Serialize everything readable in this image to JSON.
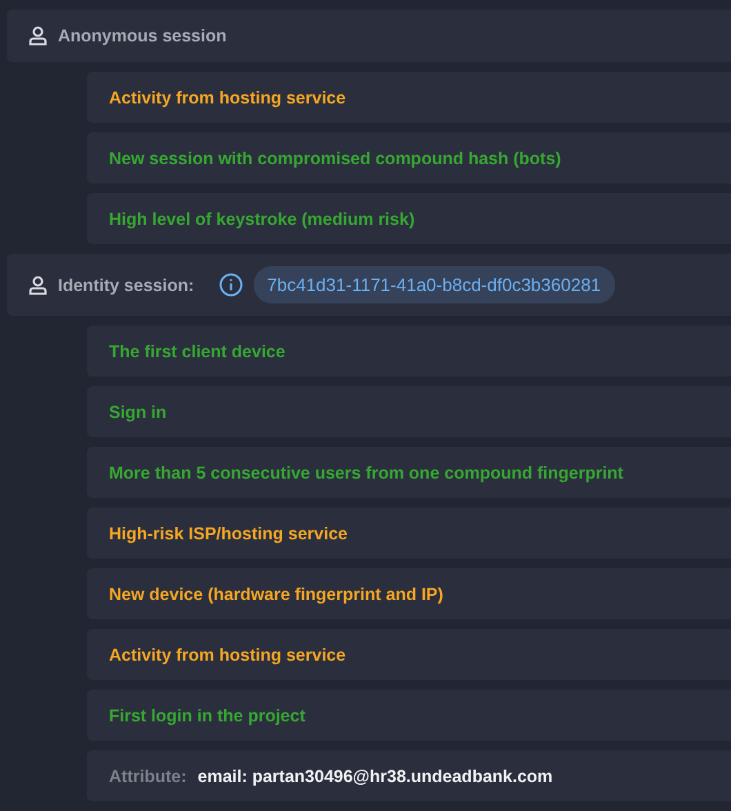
{
  "sessions": [
    {
      "title": "Anonymous session",
      "events": [
        {
          "kind": "event",
          "text": "Activity from hosting service",
          "color": "#f5a623"
        },
        {
          "kind": "event",
          "text": "New session with compromised compound hash (bots)",
          "color": "#36a832"
        },
        {
          "kind": "event",
          "text": "High level of keystroke (medium risk)",
          "color": "#36a832"
        }
      ]
    },
    {
      "title": "Identity session:",
      "id": "7bc41d31-1171-41a0-b8cd-df0c3b360281",
      "events": [
        {
          "kind": "event",
          "text": "The first client device",
          "color": "#36a832"
        },
        {
          "kind": "event",
          "text": "Sign in",
          "color": "#36a832"
        },
        {
          "kind": "event",
          "text": "More than 5 consecutive users from one compound fingerprint",
          "color": "#36a832"
        },
        {
          "kind": "event",
          "text": "High-risk ISP/hosting service",
          "color": "#f5a623"
        },
        {
          "kind": "event",
          "text": "New device (hardware fingerprint and IP)",
          "color": "#f5a623"
        },
        {
          "kind": "event",
          "text": "Activity from hosting service",
          "color": "#f5a623"
        },
        {
          "kind": "event",
          "text": "First login in the project",
          "color": "#36a832"
        },
        {
          "kind": "attribute",
          "label": "Attribute:",
          "value": "email: partan30496@hr38.undeadbank.com"
        }
      ]
    }
  ]
}
